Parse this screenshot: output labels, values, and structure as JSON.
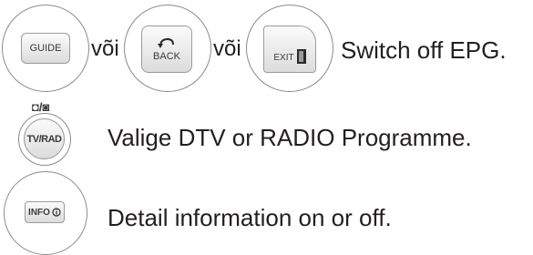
{
  "row1": {
    "guide_key": "GUIDE",
    "connector_1": "või",
    "back_key": "BACK",
    "connector_2": "või",
    "exit_key": "EXIT",
    "description": "Switch off EPG."
  },
  "row2": {
    "mode_icons": "◘/◙",
    "tvrad_key": "TV/RAD",
    "description": "Valige DTV or RADIO Programme."
  },
  "row3": {
    "info_key": "INFO",
    "description": "Detail information on or off."
  }
}
